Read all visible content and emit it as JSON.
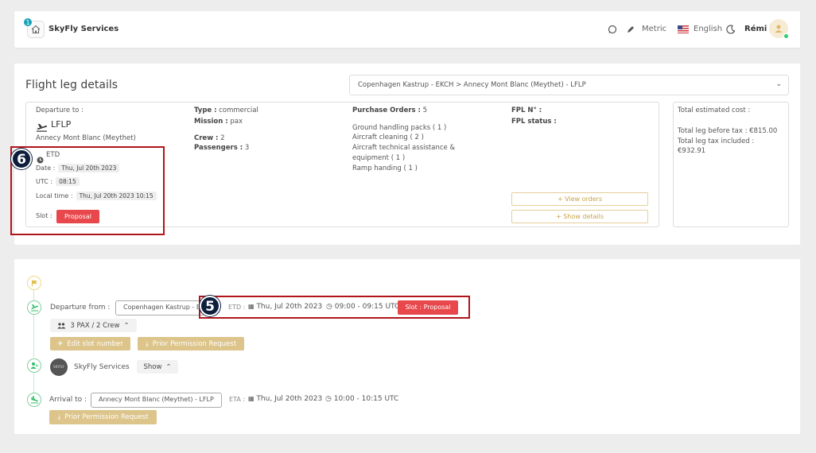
{
  "header": {
    "notification_count": "1",
    "brand": "SkyFly Services",
    "units": "Metric",
    "language": "English",
    "user": "Rémi"
  },
  "leg": {
    "title": "Flight leg details",
    "route_select": "Copenhagen Kastrup - EKCH > Annecy Mont Blanc (Meythet) - LFLP",
    "departure_label": "Departure to :",
    "dest_code": "LFLP",
    "dest_name": "Annecy Mont Blanc (Meythet)",
    "etd_label": "ETD",
    "date_label": "Date :",
    "date_value": "Thu, Jul 20th 2023",
    "utc_label": "UTC :",
    "utc_value": "08:15",
    "local_label": "Local time :",
    "local_value": "Thu, Jul 20th 2023 10:15",
    "slot_label": "Slot :",
    "slot_value": "Proposal",
    "type_label": "Type :",
    "type_value": "commercial",
    "mission_label": "Mission :",
    "mission_value": "pax",
    "crew_label": "Crew :",
    "crew_value": "2",
    "pax_label": "Passengers :",
    "pax_value": "3",
    "po_label": "Purchase Orders :",
    "po_value": "5",
    "orders": [
      "Ground handling packs ( 1 )",
      "Aircraft cleaning ( 2 )",
      "Aircraft technical assistance &",
      "equipment ( 1 )",
      "Ramp handing ( 1 )"
    ],
    "fpl_no_label": "FPL N° :",
    "fpl_status_label": "FPL status :",
    "view_orders": "+ View orders",
    "show_details": "+ Show details",
    "cost_title": "Total estimated cost :",
    "before_tax": "Total leg before tax : €815.00",
    "tax_included": "Total leg tax included :",
    "tax_included_value": "€932.91"
  },
  "timeline": {
    "departure_label": "Departure from :",
    "departure_airport": "Copenhagen Kastrup - E",
    "etd_prefix": "ETD :",
    "etd_date": "Thu, Jul 20th 2023",
    "etd_time": "09:00 - 09:15 UTC",
    "slot_badge": "Slot : Proposal",
    "pax_crew": "3 PAX  /  2 Crew",
    "edit_slot": "Edit slot number",
    "ppr_1": "Prior Permission Request",
    "operator": "SkyFly Services",
    "show": "Show",
    "arrival_label": "Arrival to :",
    "arrival_airport": "Annecy Mont Blanc (Meythet) - LFLP",
    "eta_prefix": "ETA :",
    "eta_date": "Thu, Jul 20th 2023",
    "eta_time": "10:00 - 10:15 UTC",
    "ppr_2": "Prior Permission Request",
    "logo_text": "SKYFLY"
  },
  "annotations": {
    "a6": "6",
    "a5": "5"
  },
  "colors": {
    "red": "#e8474b",
    "gold": "#dcc48a",
    "green": "#2ecc71",
    "annotation": "#b0151c"
  }
}
